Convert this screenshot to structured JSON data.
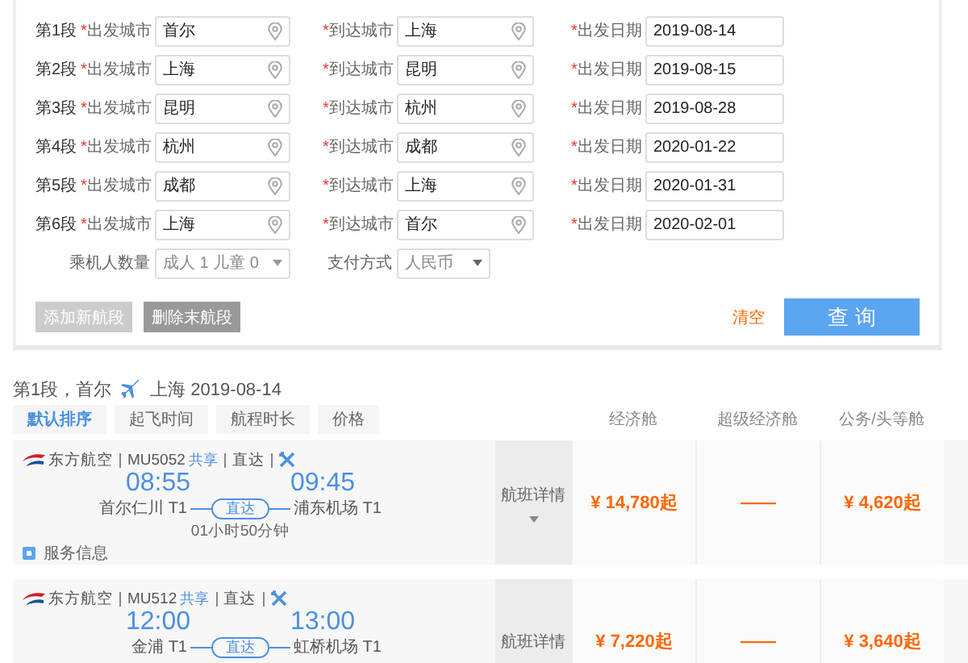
{
  "segments": [
    {
      "label": "第1段",
      "from_label": {
        "mark": "*",
        "text": "出发城市"
      },
      "from": "首尔",
      "to_label": {
        "mark": "*",
        "text": "到达城市"
      },
      "to": "上海",
      "date_label": {
        "mark": "*",
        "text": "出发日期"
      },
      "date": "2019-08-14"
    },
    {
      "label": "第2段",
      "from_label": {
        "mark": "*",
        "text": "出发城市"
      },
      "from": "上海",
      "to_label": {
        "mark": "*",
        "text": "到达城市"
      },
      "to": "昆明",
      "date_label": {
        "mark": "*",
        "text": "出发日期"
      },
      "date": "2019-08-15"
    },
    {
      "label": "第3段",
      "from_label": {
        "mark": "*",
        "text": "出发城市"
      },
      "from": "昆明",
      "to_label": {
        "mark": "*",
        "text": "到达城市"
      },
      "to": "杭州",
      "date_label": {
        "mark": "*",
        "text": "出发日期"
      },
      "date": "2019-08-28"
    },
    {
      "label": "第4段",
      "from_label": {
        "mark": "*",
        "text": "出发城市"
      },
      "from": "杭州",
      "to_label": {
        "mark": "*",
        "text": "到达城市"
      },
      "to": "成都",
      "date_label": {
        "mark": "*",
        "text": "出发日期"
      },
      "date": "2020-01-22"
    },
    {
      "label": "第5段",
      "from_label": {
        "mark": "*",
        "text": "出发城市"
      },
      "from": "成都",
      "to_label": {
        "mark": "*",
        "text": "到达城市"
      },
      "to": "上海",
      "date_label": {
        "mark": "*",
        "text": "出发日期"
      },
      "date": "2020-01-31"
    },
    {
      "label": "第6段",
      "from_label": {
        "mark": "*",
        "text": "出发城市"
      },
      "from": "上海",
      "to_label": {
        "mark": "*",
        "text": "到达城市"
      },
      "to": "首尔",
      "date_label": {
        "mark": "*",
        "text": "出发日期"
      },
      "date": "2020-02-01"
    }
  ],
  "passengers": {
    "label": "乘机人数量",
    "value": "成人 1 儿童 0"
  },
  "payment": {
    "label": "支付方式",
    "value": "人民币"
  },
  "segment_buttons": [
    {
      "label": "添加新航段",
      "disabled": true
    },
    {
      "label": "删除末航段",
      "disabled": false
    }
  ],
  "clear": "清空",
  "search": "查 询",
  "results": {
    "segment": "第1段，首尔",
    "destination": "上海 2019-08-14",
    "sort_tabs": [
      {
        "label": "默认排序",
        "selected": true
      },
      {
        "label": "起飞时间",
        "selected": false
      },
      {
        "label": "航程时长",
        "selected": false
      },
      {
        "label": "价格",
        "selected": false
      }
    ],
    "columns": [
      "经济舱",
      "超级经济舱",
      "公务/头等舱"
    ],
    "flights": [
      {
        "airline": "东方航空",
        "number": "MU5052",
        "share": "共享",
        "type": "直达",
        "depart": "08:55",
        "arrive": "09:45",
        "from_airport": "首尔仁川 T1",
        "stop": "直达",
        "to_airport": "浦东机场 T1",
        "duration": "01小时50分钟",
        "service": "服务信息",
        "details": "航班详情",
        "caret": true,
        "prices": [
          "¥ 14,780起",
          "——",
          "¥ 4,620起"
        ]
      },
      {
        "airline": "东方航空",
        "number": "MU512",
        "share": "共享",
        "type": "直达",
        "depart": "12:00",
        "arrive": "13:00",
        "from_airport": "金浦 T1",
        "stop": "直达",
        "to_airport": "虹桥机场 T1",
        "details": "航班详情",
        "prices": [
          "¥ 7,220起",
          "——",
          "¥ 3,640起"
        ]
      }
    ]
  }
}
